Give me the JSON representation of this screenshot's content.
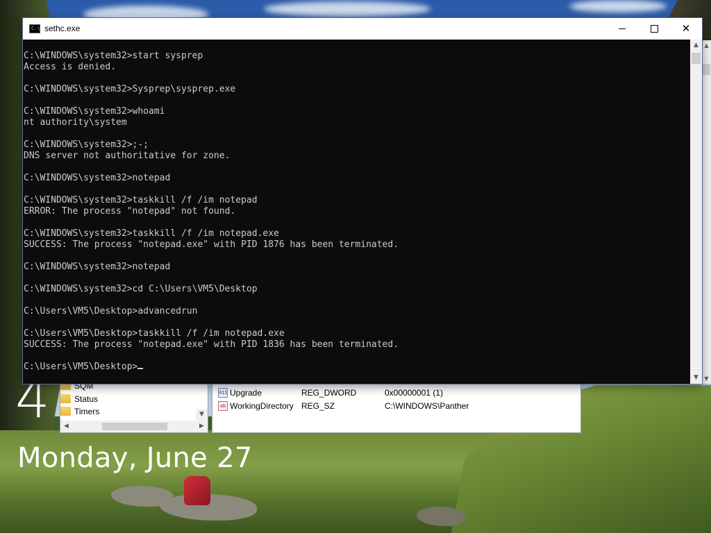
{
  "lockscreen": {
    "clock": "4",
    "date": "Monday, June 27"
  },
  "console_window": {
    "title": "sethc.exe",
    "icon": "console-icon",
    "buttons": {
      "minimize_icon": "minimize-icon",
      "maximize_icon": "maximize-icon",
      "close_icon": "close-icon"
    },
    "lines": [
      "C:\\WINDOWS\\system32>start sysprep",
      "Access is denied.",
      "",
      "C:\\WINDOWS\\system32>Sysprep\\sysprep.exe",
      "",
      "C:\\WINDOWS\\system32>whoami",
      "nt authority\\system",
      "",
      "C:\\WINDOWS\\system32>;-;",
      "DNS server not authoritative for zone.",
      "",
      "C:\\WINDOWS\\system32>notepad",
      "",
      "C:\\WINDOWS\\system32>taskkill /f /im notepad",
      "ERROR: The process \"notepad\" not found.",
      "",
      "C:\\WINDOWS\\system32>taskkill /f /im notepad.exe",
      "SUCCESS: The process \"notepad.exe\" with PID 1876 has been terminated.",
      "",
      "C:\\WINDOWS\\system32>notepad",
      "",
      "C:\\WINDOWS\\system32>cd C:\\Users\\VM5\\Desktop",
      "",
      "C:\\Users\\VM5\\Desktop>advancedrun",
      "",
      "C:\\Users\\VM5\\Desktop>taskkill /f /im notepad.exe",
      "SUCCESS: The process \"notepad.exe\" with PID 1836 has been terminated.",
      "",
      "C:\\Users\\VM5\\Desktop>"
    ]
  },
  "registry_editor": {
    "tree_items": [
      "SQM",
      "Status",
      "Timers"
    ],
    "values": [
      {
        "name": "Upgrade",
        "type": "REG_DWORD",
        "data": "0x00000001 (1)",
        "icon": "reg-dword-icon"
      },
      {
        "name": "WorkingDirectory",
        "type": "REG_SZ",
        "data": "C:\\WINDOWS\\Panther",
        "icon": "reg-sz-icon"
      }
    ]
  },
  "colors": {
    "console_bg": "#0c0c0c",
    "console_text": "#cccccc",
    "titlebar_bg": "#ffffff"
  }
}
